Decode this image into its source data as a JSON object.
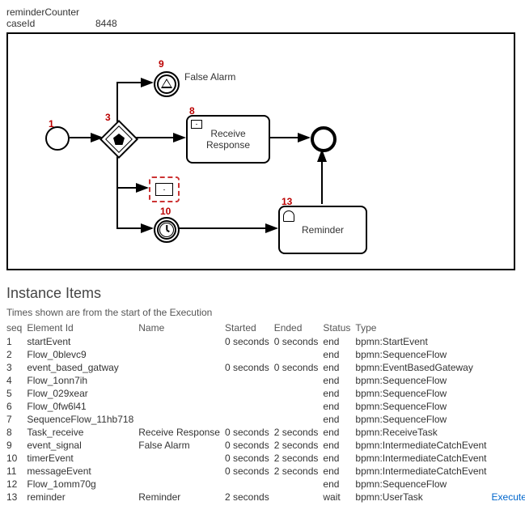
{
  "header": {
    "l1": "reminderCounter",
    "l2": "caseId",
    "caseId": "8448"
  },
  "diagram": {
    "falseAlarm": "False Alarm",
    "receiveResponse": "Receive\nResponse",
    "reminder": "Reminder",
    "b1": "1",
    "b3": "3",
    "b8": "8",
    "b9": "9",
    "b10": "10",
    "b13": "13"
  },
  "section": {
    "title": "Instance Items",
    "note": "Times shown are from the start of the Execution"
  },
  "cols": {
    "seq": "seq",
    "eid": "Element Id",
    "name": "Name",
    "started": "Started",
    "ended": "Ended",
    "status": "Status",
    "type": "Type"
  },
  "rows": [
    {
      "seq": "1",
      "eid": "startEvent",
      "name": "",
      "started": "0 seconds",
      "ended": "0 seconds",
      "status": "end",
      "type": "bpmn:StartEvent"
    },
    {
      "seq": "2",
      "eid": "Flow_0blevc9",
      "name": "",
      "started": "",
      "ended": "",
      "status": "end",
      "type": "bpmn:SequenceFlow"
    },
    {
      "seq": "3",
      "eid": "event_based_gatway",
      "name": "",
      "started": "0 seconds",
      "ended": "0 seconds",
      "status": "end",
      "type": "bpmn:EventBasedGateway"
    },
    {
      "seq": "4",
      "eid": "Flow_1onn7ih",
      "name": "",
      "started": "",
      "ended": "",
      "status": "end",
      "type": "bpmn:SequenceFlow"
    },
    {
      "seq": "5",
      "eid": "Flow_029xear",
      "name": "",
      "started": "",
      "ended": "",
      "status": "end",
      "type": "bpmn:SequenceFlow"
    },
    {
      "seq": "6",
      "eid": "Flow_0fw6l41",
      "name": "",
      "started": "",
      "ended": "",
      "status": "end",
      "type": "bpmn:SequenceFlow"
    },
    {
      "seq": "7",
      "eid": "SequenceFlow_11hb718",
      "name": "",
      "started": "",
      "ended": "",
      "status": "end",
      "type": "bpmn:SequenceFlow"
    },
    {
      "seq": "8",
      "eid": "Task_receive",
      "name": "Receive Response",
      "started": "0 seconds",
      "ended": "2 seconds",
      "status": "end",
      "type": "bpmn:ReceiveTask"
    },
    {
      "seq": "9",
      "eid": "event_signal",
      "name": "False Alarm",
      "started": "0 seconds",
      "ended": "2 seconds",
      "status": "end",
      "type": "bpmn:IntermediateCatchEvent"
    },
    {
      "seq": "10",
      "eid": "timerEvent",
      "name": "",
      "started": "0 seconds",
      "ended": "2 seconds",
      "status": "end",
      "type": "bpmn:IntermediateCatchEvent"
    },
    {
      "seq": "11",
      "eid": "messageEvent",
      "name": "",
      "started": "0 seconds",
      "ended": "2 seconds",
      "status": "end",
      "type": "bpmn:IntermediateCatchEvent"
    },
    {
      "seq": "12",
      "eid": "Flow_1omm70g",
      "name": "",
      "started": "",
      "ended": "",
      "status": "end",
      "type": "bpmn:SequenceFlow"
    },
    {
      "seq": "13",
      "eid": "reminder",
      "name": "Reminder",
      "started": "2 seconds",
      "ended": "",
      "status": "wait",
      "type": "bpmn:UserTask",
      "action": "Execute"
    }
  ]
}
